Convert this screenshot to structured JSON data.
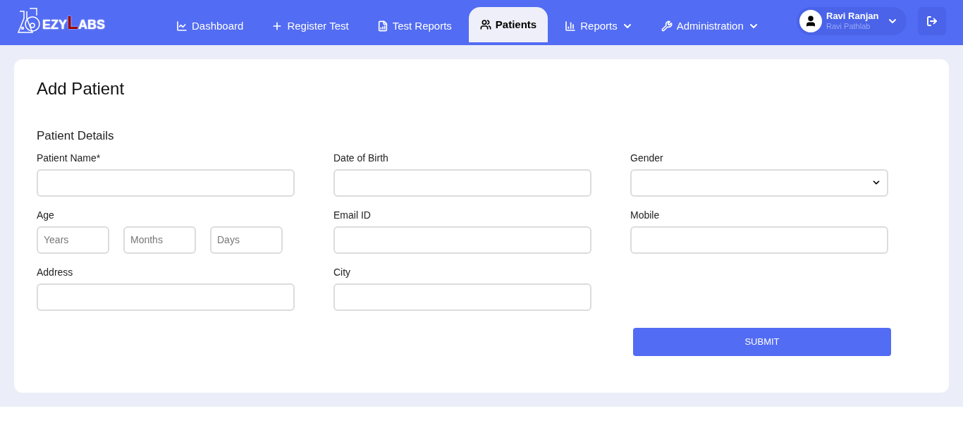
{
  "logo": {
    "parts": [
      {
        "text": "EZY",
        "color": "#ffffff"
      },
      {
        "text": "L",
        "color": "#990000"
      },
      {
        "text": "ABS",
        "color": "#ffffff"
      }
    ]
  },
  "nav": [
    {
      "label": "Dashboard",
      "dropdown": false,
      "selected": false
    },
    {
      "label": "Register Test",
      "dropdown": false,
      "selected": false
    },
    {
      "label": "Test Reports",
      "dropdown": false,
      "selected": false
    },
    {
      "label": "Patients",
      "dropdown": false,
      "selected": true
    },
    {
      "label": "Reports",
      "dropdown": true,
      "selected": false
    },
    {
      "label": "Administration",
      "dropdown": true,
      "selected": false
    }
  ],
  "user": {
    "name": "Ravi Ranjan",
    "lab": "Ravi Pathlab"
  },
  "page_title": "Add Patient",
  "section_title": "Patient Details",
  "fields": [
    {
      "kind": "text",
      "label": "Patient Name*"
    },
    {
      "kind": "text",
      "label": "Date of Birth"
    },
    {
      "kind": "select",
      "label": "Gender"
    },
    {
      "kind": "age",
      "label": "Age",
      "parts": [
        {
          "placeholder": "Years"
        },
        {
          "placeholder": "Months"
        },
        {
          "placeholder": "Days"
        }
      ]
    },
    {
      "kind": "text",
      "label": "Email ID"
    },
    {
      "kind": "text",
      "label": "Mobile"
    },
    {
      "kind": "text",
      "label": "Address"
    },
    {
      "kind": "text",
      "label": "City"
    }
  ],
  "submit": "SUBMIT"
}
